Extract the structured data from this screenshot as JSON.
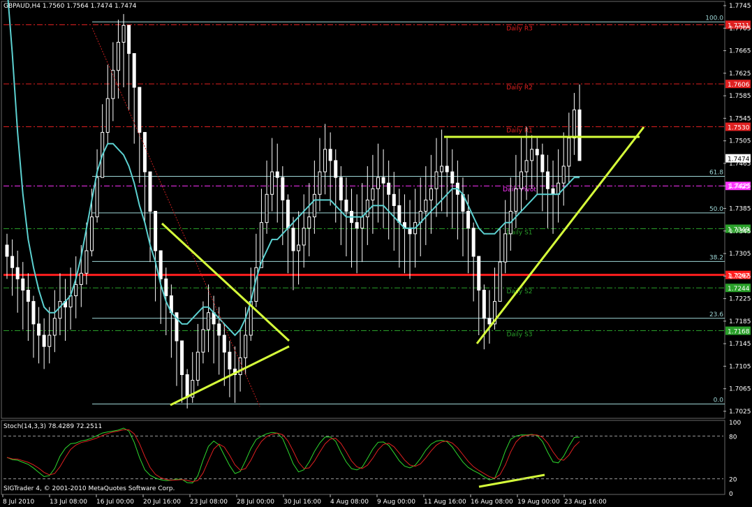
{
  "header": {
    "symbol_info": "GBPAUD,H4  1.7560 1.7564 1.7474 1.7474"
  },
  "stoch_header": "Stoch(14,3,3) 78.4289 72.2511",
  "copyright": "SIGTrader 4, © 2001-2010 MetaQuotes Software Corp.",
  "colors": {
    "background": "#000000",
    "bull_candle": "#ffffff",
    "bear_candle": "#ffffff",
    "ma_line": "#5cd1d1",
    "trend_lines": "#d6ff3a",
    "fib": "#9fd7d7",
    "pivot_red": "#e02020",
    "pivot_magenta": "#ff33ff",
    "pivot_green": "#2aa02a",
    "support_line": "#ff1e1e"
  },
  "chart_data": {
    "type": "candlestick",
    "symbol": "GBPAUD",
    "timeframe": "H4",
    "ohlc_header": [
      1.756,
      1.7564,
      1.7474,
      1.7474
    ],
    "ylim": [
      1.7015,
      1.775
    ],
    "y_ticks": [
      "1.7745",
      "1.7705",
      "1.7665",
      "1.7625",
      "1.7585",
      "1.7545",
      "1.7505",
      "1.7465",
      "1.7425",
      "1.7385",
      "1.7345",
      "1.7305",
      "1.7265",
      "1.7225",
      "1.7185",
      "1.7145",
      "1.7105",
      "1.7065",
      "1.7025"
    ],
    "x_labels": [
      "8 Jul 2010",
      "13 Jul 08:00",
      "16 Jul 00:00",
      "20 Jul 16:00",
      "23 Jul 08:00",
      "28 Jul 00:00",
      "30 Jul 16:00",
      "4 Aug 08:00",
      "9 Aug 00:00",
      "11 Aug 16:00",
      "16 Aug 08:00",
      "19 Aug 00:00",
      "23 Aug 16:00"
    ],
    "closes": [
      1.73,
      1.728,
      1.726,
      1.724,
      1.722,
      1.718,
      1.716,
      1.714,
      1.716,
      1.719,
      1.722,
      1.721,
      1.723,
      1.725,
      1.727,
      1.731,
      1.737,
      1.744,
      1.752,
      1.758,
      1.763,
      1.768,
      1.771,
      1.766,
      1.76,
      1.752,
      1.745,
      1.738,
      1.731,
      1.726,
      1.723,
      1.72,
      1.715,
      1.709,
      1.705,
      1.708,
      1.713,
      1.717,
      1.72,
      1.718,
      1.716,
      1.713,
      1.71,
      1.709,
      1.712,
      1.716,
      1.722,
      1.728,
      1.736,
      1.741,
      1.745,
      1.744,
      1.74,
      1.735,
      1.731,
      1.732,
      1.735,
      1.737,
      1.741,
      1.745,
      1.749,
      1.747,
      1.744,
      1.74,
      1.738,
      1.736,
      1.735,
      1.737,
      1.74,
      1.742,
      1.744,
      1.743,
      1.741,
      1.739,
      1.736,
      1.735,
      1.734,
      1.736,
      1.738,
      1.74,
      1.742,
      1.745,
      1.746,
      1.745,
      1.743,
      1.741,
      1.738,
      1.735,
      1.73,
      1.724,
      1.719,
      1.718,
      1.722,
      1.729,
      1.734,
      1.738,
      1.742,
      1.745,
      1.747,
      1.749,
      1.748,
      1.745,
      1.742,
      1.741,
      1.743,
      1.746,
      1.751,
      1.756,
      1.747
    ],
    "lows": [
      1.726,
      1.723,
      1.72,
      1.717,
      1.715,
      1.712,
      1.711,
      1.71,
      1.711,
      1.713,
      1.716,
      1.715,
      1.717,
      1.719,
      1.721,
      1.725,
      1.73,
      1.736,
      1.744,
      1.75,
      1.754,
      1.758,
      1.76,
      1.756,
      1.75,
      1.743,
      1.736,
      1.729,
      1.722,
      1.718,
      1.716,
      1.712,
      1.707,
      1.704,
      1.703,
      1.704,
      1.707,
      1.711,
      1.713,
      1.711,
      1.709,
      1.707,
      1.705,
      1.704,
      1.706,
      1.709,
      1.715,
      1.721,
      1.729,
      1.734,
      1.738,
      1.736,
      1.732,
      1.727,
      1.724,
      1.725,
      1.728,
      1.73,
      1.734,
      1.738,
      1.741,
      1.739,
      1.736,
      1.732,
      1.73,
      1.728,
      1.727,
      1.729,
      1.732,
      1.734,
      1.736,
      1.735,
      1.733,
      1.731,
      1.728,
      1.727,
      1.726,
      1.728,
      1.73,
      1.732,
      1.734,
      1.737,
      1.738,
      1.737,
      1.735,
      1.733,
      1.73,
      1.727,
      1.722,
      1.716,
      1.7135,
      1.7145,
      1.717,
      1.723,
      1.727,
      1.731,
      1.735,
      1.738,
      1.74,
      1.742,
      1.741,
      1.738,
      1.735,
      1.734,
      1.736,
      1.739,
      1.743,
      1.748,
      1.7474
    ],
    "highs": [
      1.734,
      1.733,
      1.731,
      1.729,
      1.727,
      1.723,
      1.721,
      1.719,
      1.721,
      1.724,
      1.727,
      1.726,
      1.728,
      1.73,
      1.732,
      1.736,
      1.742,
      1.749,
      1.757,
      1.764,
      1.768,
      1.772,
      1.773,
      1.771,
      1.765,
      1.758,
      1.751,
      1.744,
      1.737,
      1.731,
      1.728,
      1.725,
      1.72,
      1.714,
      1.71,
      1.713,
      1.718,
      1.722,
      1.725,
      1.723,
      1.721,
      1.718,
      1.715,
      1.714,
      1.717,
      1.721,
      1.728,
      1.734,
      1.742,
      1.747,
      1.751,
      1.75,
      1.746,
      1.741,
      1.737,
      1.738,
      1.741,
      1.743,
      1.747,
      1.751,
      1.7535,
      1.752,
      1.749,
      1.746,
      1.744,
      1.742,
      1.741,
      1.743,
      1.746,
      1.748,
      1.75,
      1.749,
      1.747,
      1.745,
      1.742,
      1.741,
      1.74,
      1.742,
      1.744,
      1.746,
      1.748,
      1.751,
      1.7525,
      1.751,
      1.749,
      1.747,
      1.744,
      1.741,
      1.736,
      1.73,
      1.725,
      1.724,
      1.728,
      1.735,
      1.74,
      1.744,
      1.748,
      1.751,
      1.753,
      1.7515,
      1.751,
      1.75,
      1.748,
      1.747,
      1.749,
      1.752,
      1.7555,
      1.759,
      1.7605
    ],
    "ma": [
      1.778,
      1.766,
      1.752,
      1.741,
      1.733,
      1.728,
      1.724,
      1.721,
      1.72,
      1.72,
      1.721,
      1.722,
      1.723,
      1.726,
      1.73,
      1.735,
      1.74,
      1.745,
      1.748,
      1.75,
      1.75,
      1.749,
      1.748,
      1.746,
      1.743,
      1.739,
      1.736,
      1.732,
      1.729,
      1.725,
      1.722,
      1.72,
      1.719,
      1.718,
      1.718,
      1.719,
      1.72,
      1.721,
      1.721,
      1.72,
      1.719,
      1.718,
      1.717,
      1.716,
      1.717,
      1.719,
      1.722,
      1.726,
      1.729,
      1.731,
      1.733,
      1.733,
      1.734,
      1.735,
      1.736,
      1.737,
      1.738,
      1.739,
      1.74,
      1.74,
      1.74,
      1.74,
      1.739,
      1.738,
      1.737,
      1.737,
      1.737,
      1.737,
      1.738,
      1.739,
      1.739,
      1.739,
      1.738,
      1.737,
      1.736,
      1.735,
      1.735,
      1.735,
      1.736,
      1.737,
      1.738,
      1.739,
      1.74,
      1.741,
      1.742,
      1.742,
      1.741,
      1.739,
      1.737,
      1.735,
      1.734,
      1.734,
      1.734,
      1.735,
      1.736,
      1.736,
      1.737,
      1.738,
      1.739,
      1.74,
      1.741,
      1.741,
      1.741,
      1.741,
      1.741,
      1.742,
      1.743,
      1.744,
      1.744
    ],
    "price_levels": [
      {
        "name": "Daily R3",
        "price": "1.7711",
        "color": "#e02020"
      },
      {
        "name": "Daily R2",
        "price": "1.7606",
        "color": "#e02020"
      },
      {
        "name": "Daily R1",
        "price": "1.7530",
        "color": "#e02020"
      },
      {
        "name": "Daily Pivot",
        "price": "1.7425",
        "color": "#ff33ff"
      },
      {
        "name": "Daily S1",
        "price": "1.7349",
        "color": "#2aa02a"
      },
      {
        "name": "Daily S2",
        "price": "1.7244",
        "color": "#2aa02a"
      },
      {
        "name": "Daily S3",
        "price": "1.7168",
        "color": "#2aa02a"
      }
    ],
    "support_line": {
      "price": "1.7267",
      "color": "#ff1e1e"
    },
    "current_price": "1.7474",
    "fib_levels": [
      {
        "label": "100.0",
        "price": 1.7716
      },
      {
        "label": "61.8",
        "price": 1.7442
      },
      {
        "label": "50.0",
        "price": 1.7377
      },
      {
        "label": "38.2",
        "price": 1.7291
      },
      {
        "label": "23.6",
        "price": 1.719
      },
      {
        "label": "0.0",
        "price": 1.7038
      }
    ],
    "trendlines": [
      {
        "from": [
          1.737,
          "20 Jul 16:00"
        ],
        "to": [
          1.716,
          "30 Jul 16:00"
        ]
      },
      {
        "from": [
          1.704,
          "22 Jul"
        ],
        "to": [
          1.714,
          "30 Jul 16:00"
        ]
      },
      {
        "from": [
          1.714,
          "16 Aug 08:00"
        ],
        "to": [
          1.7545,
          "25 Aug"
        ]
      },
      {
        "from": [
          1.7525,
          "12 Aug"
        ],
        "to": [
          1.7525,
          "24 Aug"
        ]
      }
    ],
    "stoch": {
      "k": 78.4289,
      "d": 72.2511,
      "levels": [
        "100",
        "80",
        "20",
        "0"
      ]
    }
  }
}
